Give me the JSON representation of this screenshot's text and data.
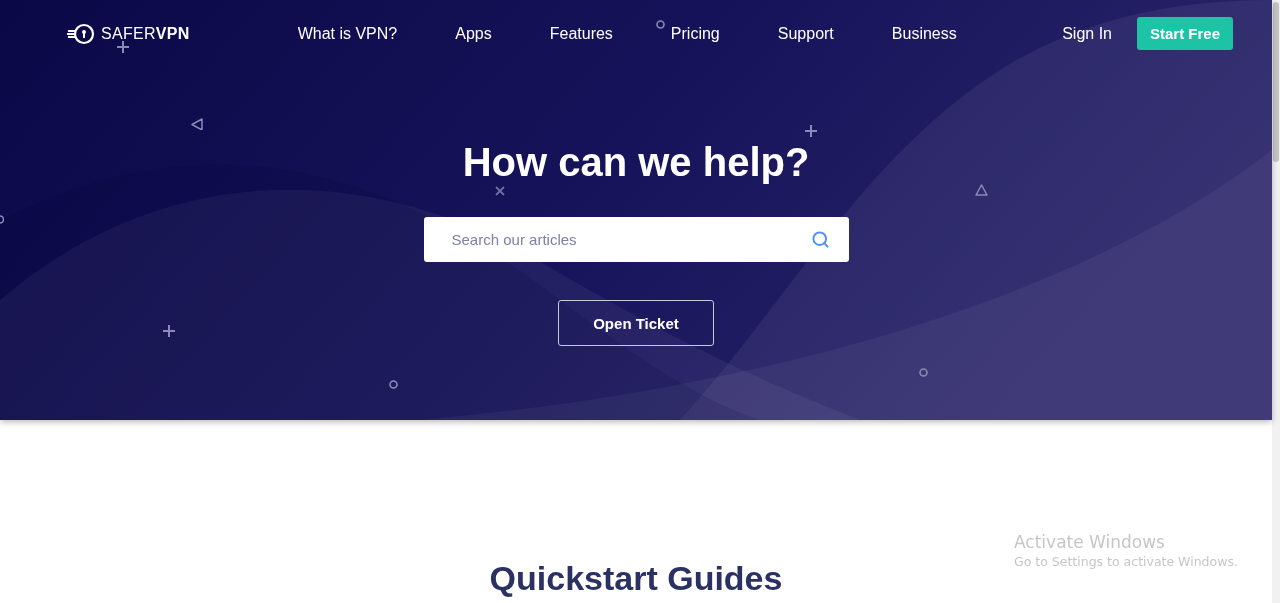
{
  "logo": {
    "text": "SAFER**VPN**"
  },
  "nav": {
    "links": [
      "What is VPN?",
      "Apps",
      "Features",
      "Pricing",
      "Support",
      "Business"
    ],
    "sign_in": "Sign In",
    "cta": "Start Free"
  },
  "hero": {
    "title": "How can we help?",
    "search": {
      "placeholder": "Search our articles"
    },
    "button": "Open Ticket"
  },
  "section": {
    "title": "Quickstart Guides"
  },
  "os_notice": {
    "title": "Activate Windows",
    "text": "Go to Settings to activate Windows."
  }
}
